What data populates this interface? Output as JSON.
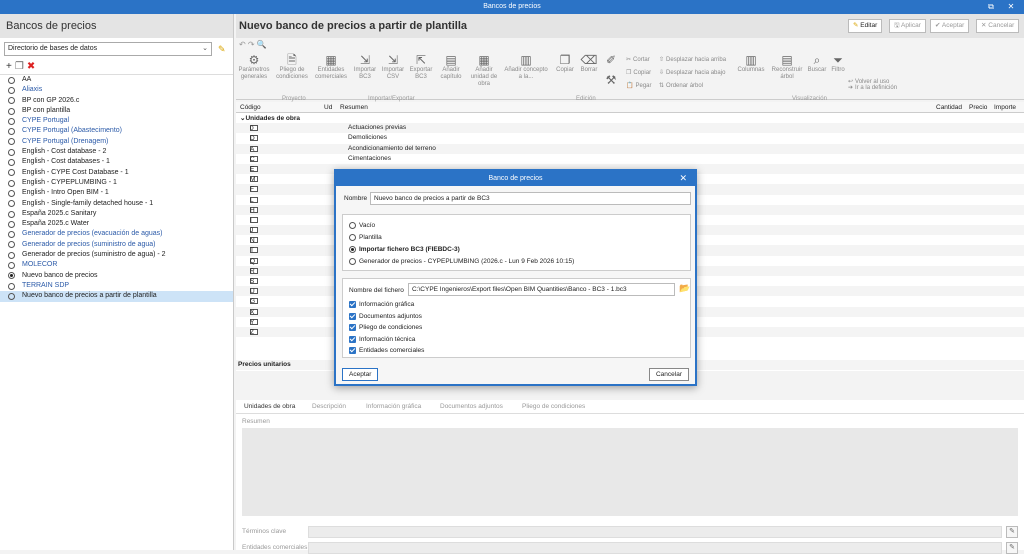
{
  "window": {
    "title": "Bancos de precios",
    "restore_glyph": "⧉",
    "close_glyph": "✕"
  },
  "left": {
    "header": "Bancos de precios",
    "directory": "Directorio de bases de datos",
    "items": [
      {
        "label": "AA",
        "blue": false,
        "checked": false
      },
      {
        "label": "Aliaxis",
        "blue": true,
        "checked": false
      },
      {
        "label": "BP con GP 2026.c",
        "blue": false,
        "checked": false
      },
      {
        "label": "BP con plantilla",
        "blue": false,
        "checked": false
      },
      {
        "label": "CYPE Portugal",
        "blue": true,
        "checked": false
      },
      {
        "label": "CYPE Portugal (Abastecimento)",
        "blue": true,
        "checked": false
      },
      {
        "label": "CYPE Portugal (Drenagem)",
        "blue": true,
        "checked": false
      },
      {
        "label": "English - Cost database - 2",
        "blue": false,
        "checked": false
      },
      {
        "label": "English - Cost databases - 1",
        "blue": false,
        "checked": false
      },
      {
        "label": "English - CYPE Cost Database - 1",
        "blue": false,
        "checked": false
      },
      {
        "label": "English - CYPEPLUMBING - 1",
        "blue": false,
        "checked": false
      },
      {
        "label": "English - Intro Open BIM - 1",
        "blue": false,
        "checked": false
      },
      {
        "label": "English - Single-family detached house - 1",
        "blue": false,
        "checked": false
      },
      {
        "label": "España 2025.c Sanitary",
        "blue": false,
        "checked": false
      },
      {
        "label": "España 2025.c Water",
        "blue": false,
        "checked": false
      },
      {
        "label": "Generador de precios (evacuación de aguas)",
        "blue": true,
        "checked": false
      },
      {
        "label": "Generador de precios (suministro de agua)",
        "blue": true,
        "checked": false
      },
      {
        "label": "Generador de precios (suministro de agua) - 2",
        "blue": false,
        "checked": false
      },
      {
        "label": "MOLECOR",
        "blue": true,
        "checked": false
      },
      {
        "label": "Nuevo banco de precios",
        "blue": false,
        "checked": true
      },
      {
        "label": "TERRAIN SDP",
        "blue": true,
        "checked": false
      },
      {
        "label": "Nuevo banco de precios a partir de plantilla",
        "blue": false,
        "checked": false,
        "selected": true
      }
    ]
  },
  "main": {
    "title": "Nuevo banco de precios a partir de plantilla",
    "buttons": {
      "edit": "Editar",
      "apply": "Aplicar",
      "accept": "Aceptar",
      "cancel": "Cancelar"
    },
    "ribbon": {
      "params": "Parámetros generales",
      "pliego": "Pliego de condiciones",
      "entidades": "Entidades comerciales",
      "imp_bc3": "Importar BC3",
      "imp_csv": "Importar CSV",
      "exp_bc3": "Exportar BC3",
      "add_cap": "Añadir capítulo",
      "add_ud": "Añadir unidad de obra",
      "add_con": "Añadir concepto a la...",
      "copiar": "Copiar",
      "borrar": "Borrar",
      "cortar": "Cortar",
      "copiar2": "Copiar",
      "pegar": "Pegar",
      "desp_arriba": "Desplazar hacia arriba",
      "desp_abajo": "Desplazar hacia abajo",
      "ordenar": "Ordenar árbol",
      "columnas": "Columnas",
      "reconstruir": "Reconstruir árbol",
      "buscar": "Buscar",
      "filtro": "Filtro",
      "ir_def": "Ir a la definición",
      "volver": "Volver al uso",
      "g_proyecto": "Proyecto",
      "g_impexp": "Importar/Exportar",
      "g_edicion": "Edición",
      "g_vis": "Visualización"
    },
    "grid": {
      "headers": {
        "codigo": "Código",
        "ud": "Ud",
        "resumen": "Resumen",
        "cantidad": "Cantidad",
        "precio": "Precio",
        "importe": "Importe"
      },
      "root": "Unidades de obra",
      "rows": [
        {
          "code": "0",
          "resumen": "Actuaciones previas"
        },
        {
          "code": "D",
          "resumen": "Demoliciones"
        },
        {
          "code": "A",
          "resumen": "Acondicionamiento del terreno"
        },
        {
          "code": "C",
          "resumen": "Cimentaciones"
        },
        {
          "code": "E",
          "resumen": ""
        },
        {
          "code": "M",
          "resumen": ""
        },
        {
          "code": "F",
          "resumen": ""
        },
        {
          "code": "L",
          "resumen": ""
        },
        {
          "code": "H",
          "resumen": ""
        },
        {
          "code": "I",
          "resumen": ""
        },
        {
          "code": "J",
          "resumen": ""
        },
        {
          "code": "N",
          "resumen": ""
        },
        {
          "code": "T",
          "resumen": ""
        },
        {
          "code": "Q",
          "resumen": ""
        },
        {
          "code": "R",
          "resumen": ""
        },
        {
          "code": "S",
          "resumen": ""
        },
        {
          "code": "U",
          "resumen": ""
        },
        {
          "code": "G",
          "resumen": ""
        },
        {
          "code": "X",
          "resumen": ""
        },
        {
          "code": "Y",
          "resumen": ""
        },
        {
          "code": "Z",
          "resumen": ""
        }
      ],
      "footer": "Precios unitarios"
    },
    "tabs": [
      "Unidades de obra",
      "Descripción",
      "Información gráfica",
      "Documentos adjuntos",
      "Pliego de condiciones"
    ],
    "resumen_label": "Resumen",
    "terminos": "Términos clave",
    "entidades_label": "Entidades comerciales"
  },
  "dialog": {
    "title": "Banco de precios",
    "close_glyph": "✕",
    "name_label": "Nombre",
    "name_value": "Nuevo banco de precios a partir de BC3",
    "options": [
      {
        "label": "Vacío",
        "on": false,
        "bold": false
      },
      {
        "label": "Plantilla",
        "on": false,
        "bold": false
      },
      {
        "label": "Importar fichero BC3 (FIEBDC-3)",
        "on": true,
        "bold": true
      },
      {
        "label": "Generador de precios - CYPEPLUMBING (2026.c - Lun  9 Feb 2026  10:15)",
        "on": false,
        "bold": false
      }
    ],
    "file_label": "Nombre del fichero",
    "file_value": "C:\\CYPE Ingenieros\\Export files\\Open BIM Quantities\\Banco - BC3 - 1.bc3",
    "checks": [
      "Información gráfica",
      "Documentos adjuntos",
      "Pliego de condiciones",
      "Información técnica",
      "Entidades comerciales"
    ],
    "accept": "Aceptar",
    "cancel": "Cancelar"
  }
}
